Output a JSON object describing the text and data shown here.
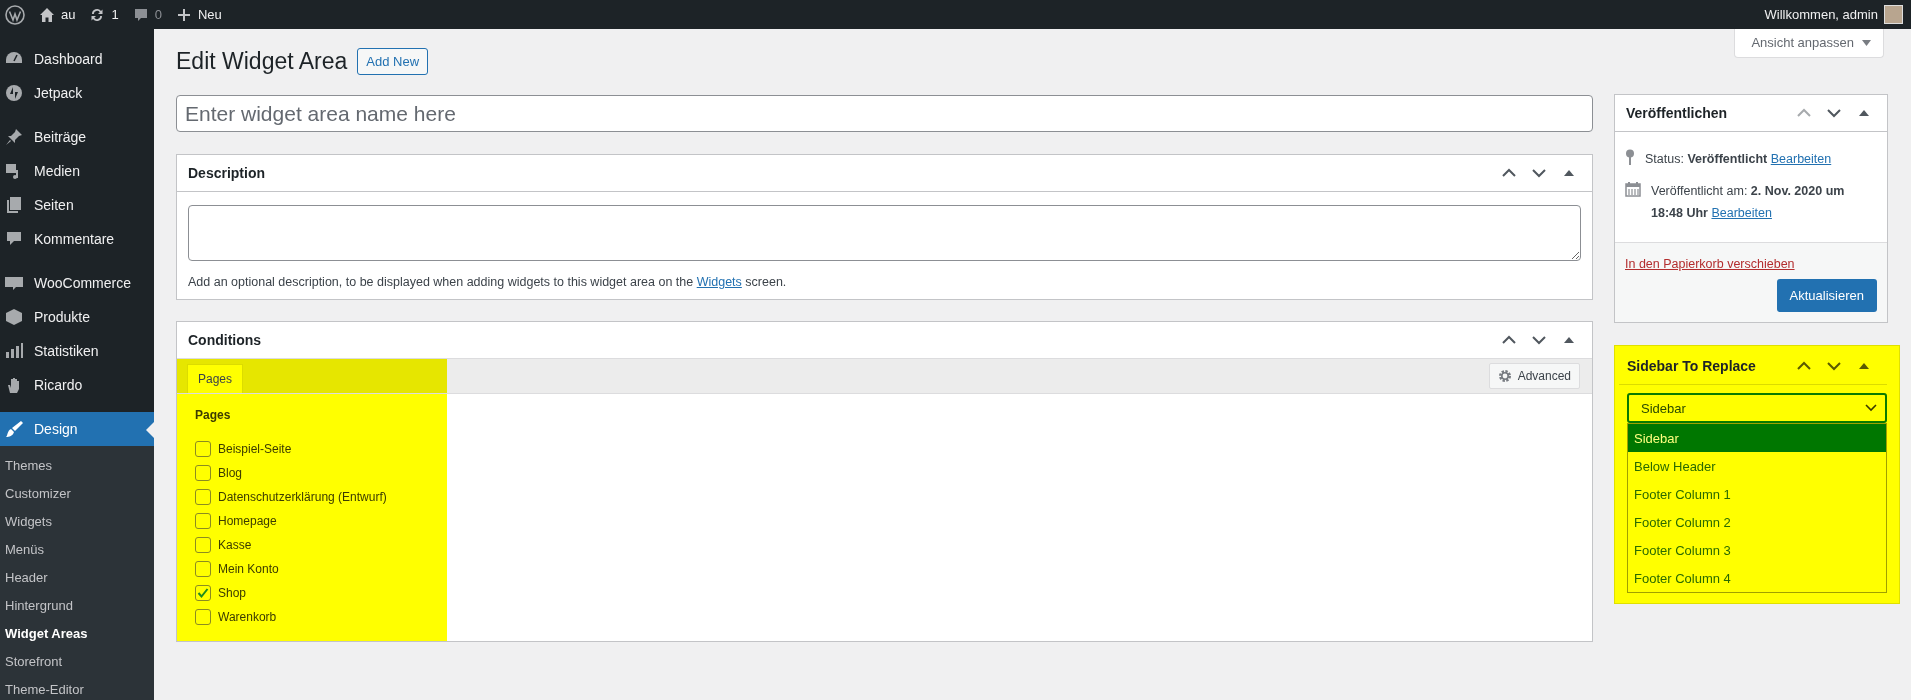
{
  "admin_bar": {
    "site": "au",
    "updates": "1",
    "comments": "0",
    "new": "Neu",
    "greeting": "Willkommen, admin"
  },
  "sidebar": {
    "groups": [
      {
        "items": [
          {
            "label": "Dashboard",
            "kind": "gauge",
            "selected": false
          },
          {
            "label": "Jetpack",
            "kind": "bolt",
            "selected": false
          }
        ]
      },
      {
        "items": [
          {
            "label": "Beiträge",
            "kind": "pin",
            "selected": false
          },
          {
            "label": "Medien",
            "kind": "media",
            "selected": false
          },
          {
            "label": "Seiten",
            "kind": "pages",
            "selected": false
          },
          {
            "label": "Kommentare",
            "kind": "comment",
            "selected": false
          }
        ]
      },
      {
        "items": [
          {
            "label": "WooCommerce",
            "kind": "woo",
            "selected": false
          },
          {
            "label": "Produkte",
            "kind": "box",
            "selected": false
          },
          {
            "label": "Statistiken",
            "kind": "chart",
            "selected": false
          },
          {
            "label": "Ricardo",
            "kind": "hand",
            "selected": false
          }
        ]
      },
      {
        "items": [
          {
            "label": "Design",
            "kind": "brush",
            "selected": true
          }
        ]
      }
    ],
    "submenu": [
      {
        "label": "Themes",
        "selected": false
      },
      {
        "label": "Customizer",
        "selected": false
      },
      {
        "label": "Widgets",
        "selected": false
      },
      {
        "label": "Menüs",
        "selected": false
      },
      {
        "label": "Header",
        "selected": false
      },
      {
        "label": "Hintergrund",
        "selected": false
      },
      {
        "label": "Widget Areas",
        "selected": true
      },
      {
        "label": "Storefront",
        "selected": false
      },
      {
        "label": "Theme-Editor",
        "selected": false
      }
    ]
  },
  "screen_options": "Ansicht anpassen",
  "title": "Edit Widget Area",
  "add_new": "Add New",
  "name_field": {
    "placeholder": "Enter widget area name here"
  },
  "description_box": {
    "title": "Description",
    "help_before": "Add an optional description, to be displayed when adding widgets to this widget area on the ",
    "help_link": "Widgets",
    "help_after": " screen."
  },
  "conditions_box": {
    "title": "Conditions",
    "tabs": [
      {
        "label": "Pages",
        "selected": true
      }
    ],
    "advanced": "Advanced",
    "section_title": "Pages",
    "pages": [
      {
        "label": "Beispiel-Seite",
        "checked": false
      },
      {
        "label": "Blog",
        "checked": false
      },
      {
        "label": "Datenschutzerklärung (Entwurf)",
        "checked": false
      },
      {
        "label": "Homepage",
        "checked": false
      },
      {
        "label": "Kasse",
        "checked": false
      },
      {
        "label": "Mein Konto",
        "checked": false
      },
      {
        "label": "Shop",
        "checked": true
      },
      {
        "label": "Warenkorb",
        "checked": false
      }
    ]
  },
  "publish_box": {
    "title": "Veröffentlichen",
    "status": "Status: **Veröffentlicht**",
    "status_edit": "Bearbeiten",
    "date": "Veröffentlicht am: **2. Nov. 2020 um 18:48 Uhr**",
    "date_edit": "Bearbeiten",
    "trash": "In den Papierkorb verschieben",
    "update": "Aktualisieren"
  },
  "replace_box": {
    "title": "Sidebar To Replace",
    "value": "Sidebar",
    "options": [
      {
        "label": "Sidebar",
        "selected": true
      },
      {
        "label": "Below Header",
        "selected": false
      },
      {
        "label": "Footer Column 1",
        "selected": false
      },
      {
        "label": "Footer Column 2",
        "selected": false
      },
      {
        "label": "Footer Column 3",
        "selected": false
      },
      {
        "label": "Footer Column 4",
        "selected": false
      }
    ]
  }
}
